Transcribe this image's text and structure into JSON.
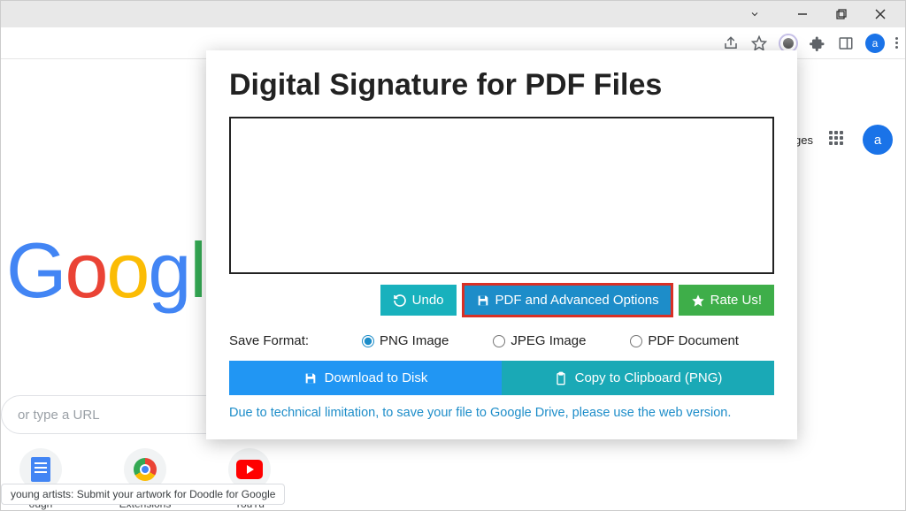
{
  "window": {
    "avatar_letter": "a"
  },
  "google": {
    "header_link": "ges",
    "avatar_letter": "a",
    "search_placeholder": "or type a URL",
    "tiles": [
      {
        "label": "ough"
      },
      {
        "label": "Extensions"
      },
      {
        "label": "YouTu"
      }
    ],
    "footer_chip": "young artists: Submit your artwork for Doodle for Google"
  },
  "popup": {
    "title": "Digital Signature for PDF Files",
    "buttons": {
      "undo": "Undo",
      "pdf": "PDF and Advanced Options",
      "rate": "Rate Us!"
    },
    "save_format_label": "Save Format:",
    "formats": {
      "png": "PNG Image",
      "jpeg": "JPEG Image",
      "pdf": "PDF Document"
    },
    "selected_format": "png",
    "download_disk": "Download to Disk",
    "copy_clipboard": "Copy to Clipboard (PNG)",
    "note": "Due to technical limitation, to save your file to Google Drive, please use the web version."
  }
}
